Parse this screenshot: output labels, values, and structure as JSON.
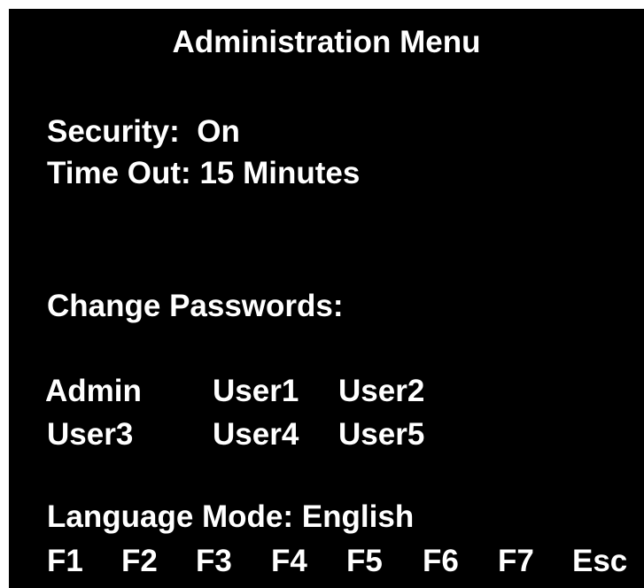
{
  "title": "Administration Menu",
  "status": {
    "security_label": "Security:",
    "security_value": "On",
    "timeout_label": "Time Out:",
    "timeout_value": "15 Minutes"
  },
  "passwords": {
    "heading": "Change Passwords:",
    "users": [
      "Admin",
      "User1",
      "User2",
      "User3",
      "User4",
      "User5"
    ]
  },
  "language": {
    "label": "Language Mode:",
    "value": "English"
  },
  "function_keys": [
    "F1",
    "F2",
    "F3",
    "F4",
    "F5",
    "F6",
    "F7",
    "Esc"
  ],
  "colors": {
    "background": "#000000",
    "text": "#ffffff"
  }
}
